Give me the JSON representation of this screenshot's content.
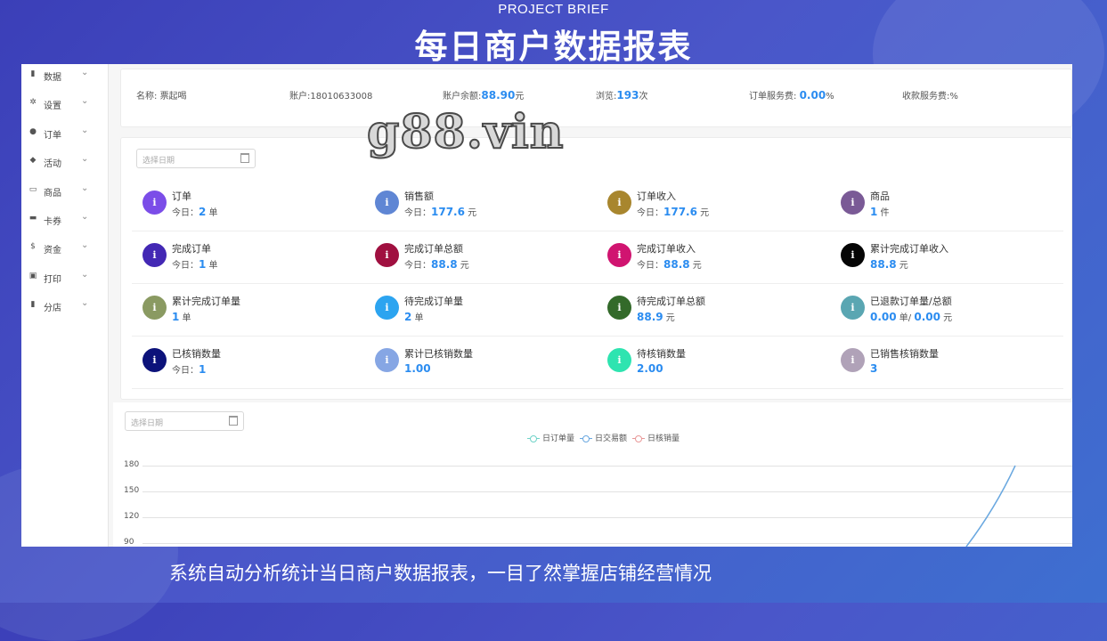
{
  "header": {
    "eyebrow": "PROJECT BRIEF",
    "title": "每日商户数据报表"
  },
  "caption": "系统自动分析统计当日商户数据报表，一目了然掌握店铺经营情况",
  "watermark": "g88.vin",
  "sidebar": {
    "items": [
      {
        "label": "数据",
        "icon": "bar-chart-icon",
        "glyph": "▮"
      },
      {
        "label": "设置",
        "icon": "gear-icon",
        "glyph": "✲"
      },
      {
        "label": "订单",
        "icon": "info-circle-icon",
        "glyph": "●"
      },
      {
        "label": "活动",
        "icon": "tag-icon",
        "glyph": "◆"
      },
      {
        "label": "商品",
        "icon": "printer-icon",
        "glyph": "▭"
      },
      {
        "label": "卡券",
        "icon": "card-icon",
        "glyph": "▬"
      },
      {
        "label": "资金",
        "icon": "dollar-icon",
        "glyph": "$"
      },
      {
        "label": "打印",
        "icon": "print-icon",
        "glyph": "▣"
      },
      {
        "label": "分店",
        "icon": "bar-chart-icon",
        "glyph": "▮"
      }
    ],
    "chevron": "⌄"
  },
  "info": {
    "name_label": "名称:",
    "name_value": "票起喝",
    "account_label": "账户:",
    "account_value": "18010633008",
    "balance_label": "账户余额:",
    "balance_value": "88.90",
    "balance_unit": "元",
    "views_label": "浏览:",
    "views_value": "193",
    "views_unit": "次",
    "order_fee_label": "订单服务费:",
    "order_fee_value": "0.00",
    "order_fee_unit": "%",
    "collect_fee_label": "收款服务费:",
    "collect_fee_unit": "%"
  },
  "date_placeholder": "选择日期",
  "stats": [
    {
      "title": "订单",
      "prefix": "今日：",
      "value": "2",
      "unit": "单",
      "color": "#7b4de8"
    },
    {
      "title": "销售额",
      "prefix": "今日：",
      "value": "177.6",
      "unit": "元",
      "color": "#5f86d4"
    },
    {
      "title": "订单收入",
      "prefix": "今日：",
      "value": "177.6",
      "unit": "元",
      "color": "#a8862e"
    },
    {
      "title": "商品",
      "prefix": "",
      "value": "1",
      "unit": "件",
      "color": "#7a5a96"
    },
    {
      "title": "完成订单",
      "prefix": "今日：",
      "value": "1",
      "unit": "单",
      "color": "#4328b4"
    },
    {
      "title": "完成订单总额",
      "prefix": "今日：",
      "value": "88.8",
      "unit": "元",
      "color": "#a01040"
    },
    {
      "title": "完成订单收入",
      "prefix": "今日：",
      "value": "88.8",
      "unit": "元",
      "color": "#d01470"
    },
    {
      "title": "累计完成订单收入",
      "prefix": "",
      "value": "88.8",
      "unit": "元",
      "color": "#050505"
    },
    {
      "title": "累计完成订单量",
      "prefix": "",
      "value": "1",
      "unit": "单",
      "color": "#8a9a62"
    },
    {
      "title": "待完成订单量",
      "prefix": "",
      "value": "2",
      "unit": "单",
      "color": "#2ca4f0"
    },
    {
      "title": "待完成订单总额",
      "prefix": "",
      "value": "88.9",
      "unit": "元",
      "color": "#336a2a"
    },
    {
      "title": "已退款订单量/总额",
      "prefix": "",
      "value": "0.00",
      "unit": "单/",
      "value2": "0.00",
      "unit2": "元",
      "color": "#5aa6b2"
    },
    {
      "title": "已核销数量",
      "prefix": "今日：",
      "value": "1",
      "unit": "",
      "color": "#0c127a"
    },
    {
      "title": "累计已核销数量",
      "prefix": "",
      "value": "1.00",
      "unit": "",
      "color": "#86a6e4"
    },
    {
      "title": "待核销数量",
      "prefix": "",
      "value": "2.00",
      "unit": "",
      "color": "#2ee4b0"
    },
    {
      "title": "已销售核销数量",
      "prefix": "",
      "value": "3",
      "unit": "",
      "color": "#b0a2b8"
    }
  ],
  "stat_icon_glyph": "i",
  "chart_data": {
    "type": "line",
    "series": [
      {
        "name": "日订单量",
        "color": "#6fd3c8"
      },
      {
        "name": "日交易额",
        "color": "#6aa8e0"
      },
      {
        "name": "日核销量",
        "color": "#e89898"
      }
    ],
    "y_ticks": [
      "180",
      "150",
      "120",
      "90"
    ],
    "ylim": [
      90,
      180
    ],
    "grid": true,
    "legend": "top-center"
  }
}
